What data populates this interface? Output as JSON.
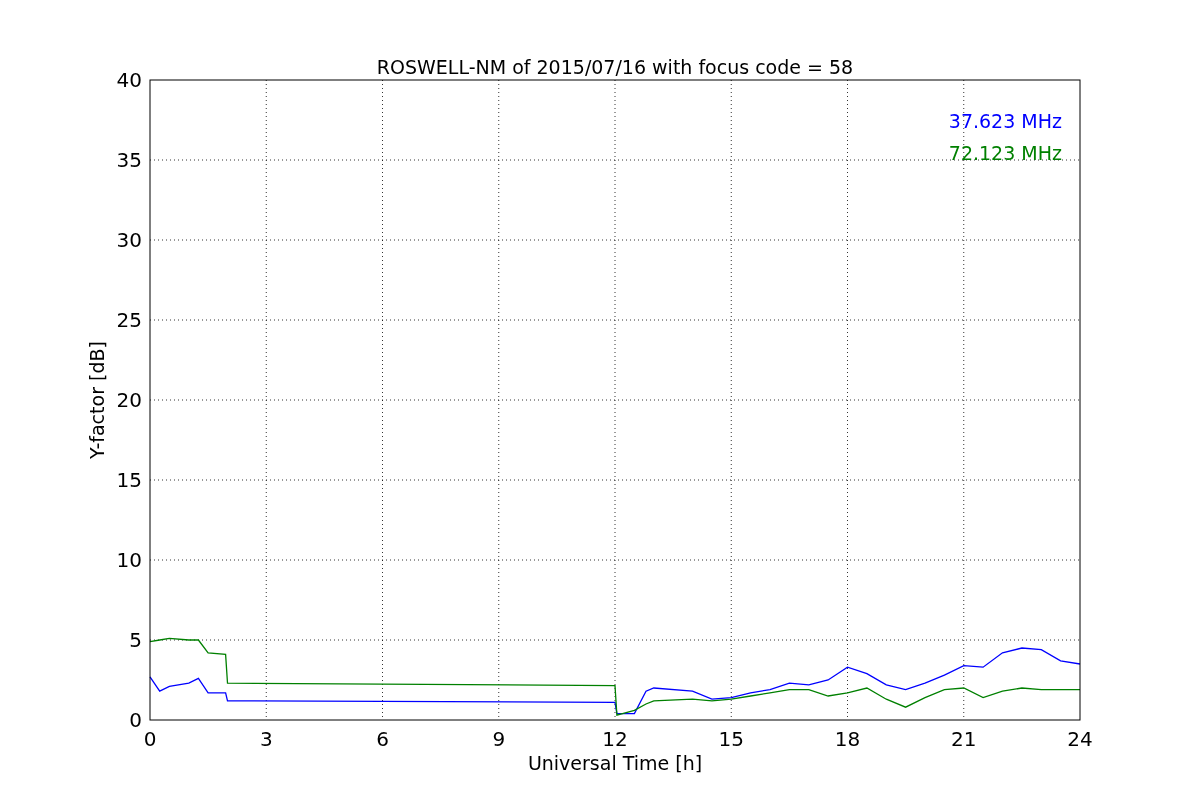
{
  "chart": {
    "chart_data": {
      "type": "line",
      "title": "ROSWELL-NM of 2015/07/16 with focus code = 58",
      "xlabel": "Universal Time [h]",
      "ylabel": "Y-factor [dB]",
      "x": [
        0,
        0.25,
        0.5,
        1,
        1.25,
        1.5,
        1.95,
        2,
        12,
        12.05,
        12.5,
        12.8,
        13,
        14,
        14.5,
        15,
        15.5,
        16,
        16.5,
        17,
        17.5,
        18,
        18.5,
        19,
        19.5,
        20,
        20.5,
        21,
        21.5,
        22,
        22.5,
        23,
        23.5,
        24
      ],
      "series": [
        {
          "name": "37.623 MHz",
          "color": "#0000ff",
          "values": [
            2.7,
            1.8,
            2.1,
            2.3,
            2.6,
            1.7,
            1.7,
            1.2,
            1.1,
            0.4,
            0.4,
            1.8,
            2.0,
            1.8,
            1.3,
            1.4,
            1.7,
            1.9,
            2.3,
            2.2,
            2.5,
            3.3,
            2.9,
            2.2,
            1.9,
            2.3,
            2.8,
            3.4,
            3.3,
            4.2,
            4.5,
            4.4,
            3.7,
            3.5
          ]
        },
        {
          "name": "72.123 MHz",
          "color": "#008000",
          "values": [
            4.9,
            5.0,
            5.1,
            5.0,
            5.0,
            4.2,
            4.1,
            2.3,
            2.15,
            0.3,
            0.6,
            1.0,
            1.2,
            1.3,
            1.2,
            1.3,
            1.5,
            1.7,
            1.9,
            1.9,
            1.5,
            1.7,
            2.0,
            1.3,
            0.8,
            1.4,
            1.9,
            2.0,
            1.4,
            1.8,
            2.0,
            1.9,
            1.9,
            1.9
          ]
        }
      ],
      "grid": true,
      "xlim": [
        0,
        24
      ],
      "ylim": [
        0,
        40
      ],
      "xticks": [
        0,
        3,
        6,
        9,
        12,
        15,
        18,
        21,
        24
      ],
      "yticks": [
        0,
        5,
        10,
        15,
        20,
        25,
        30,
        35,
        40
      ]
    }
  }
}
